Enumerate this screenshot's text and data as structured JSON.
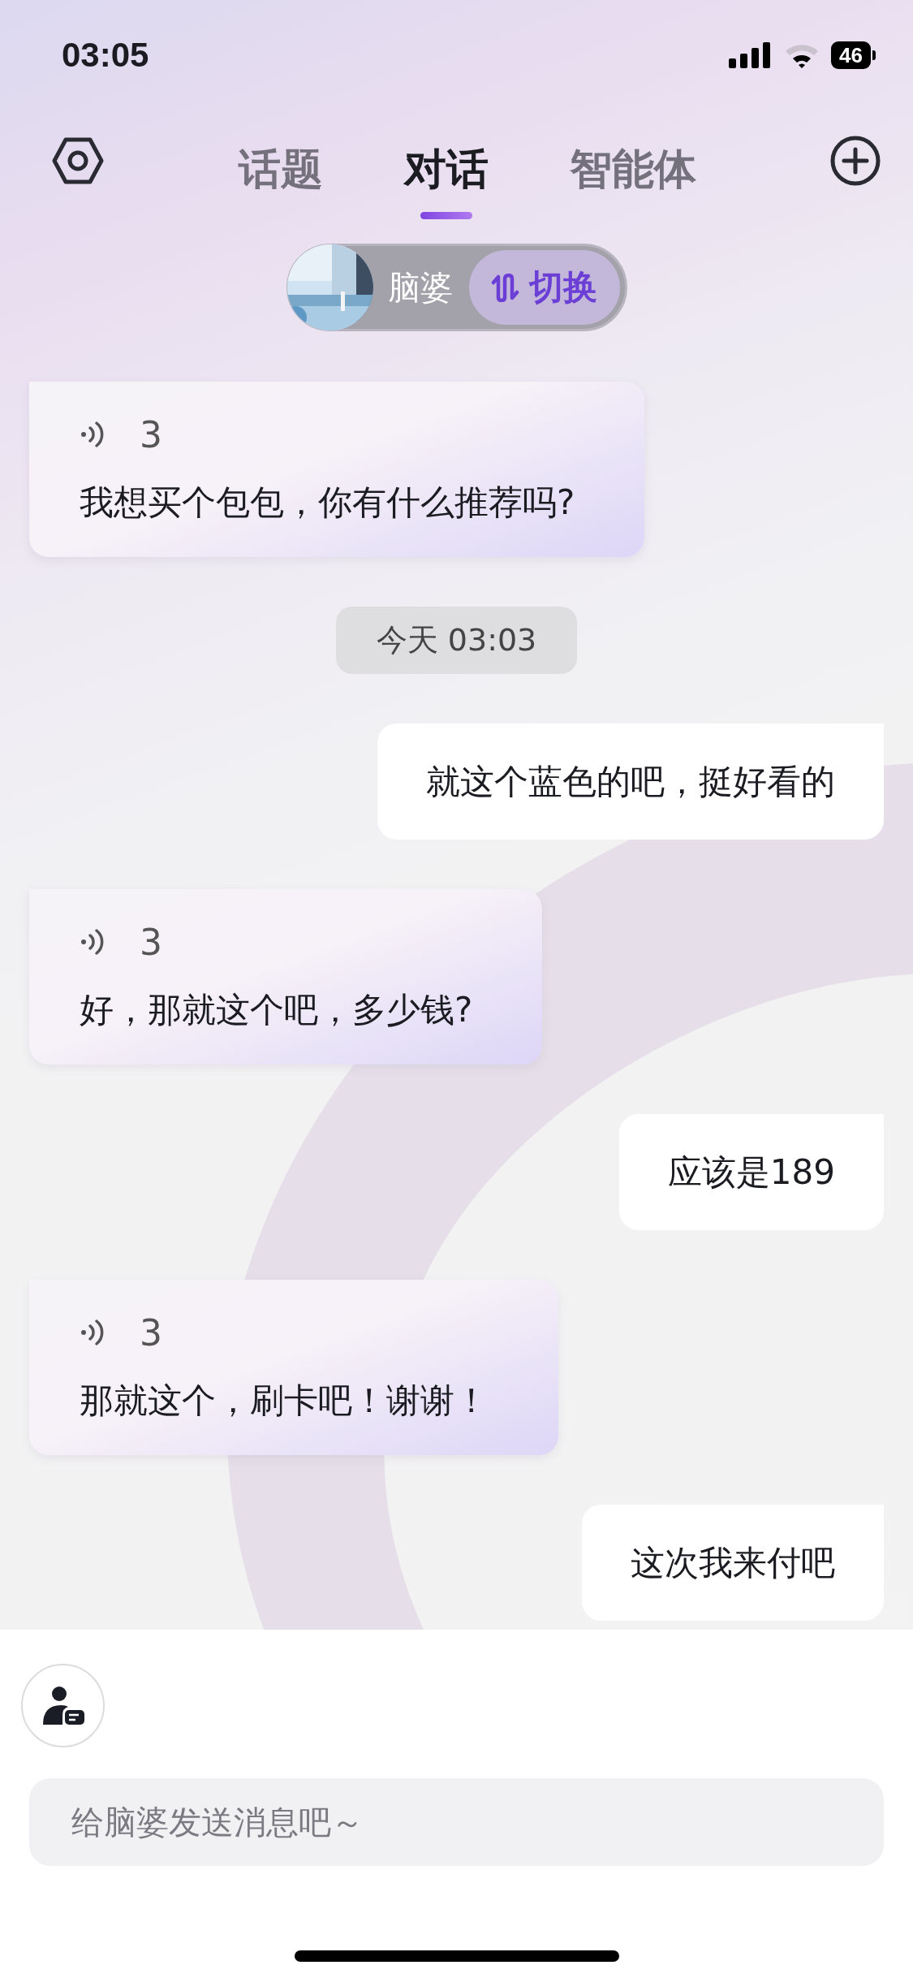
{
  "status_bar": {
    "time": "03:05",
    "battery": "46"
  },
  "tabs": [
    {
      "label": "话题",
      "selected": false
    },
    {
      "label": "对话",
      "selected": true
    },
    {
      "label": "智能体",
      "selected": false
    }
  ],
  "persona": {
    "name": "脑婆",
    "switch_label": "切换"
  },
  "messages": [
    {
      "kind": "bot",
      "count": "3",
      "text": "我想买个包包，你有什么推荐吗?"
    },
    {
      "kind": "time",
      "text": "今天 03:03"
    },
    {
      "kind": "user",
      "text": "就这个蓝色的吧，挺好看的"
    },
    {
      "kind": "bot",
      "count": "3",
      "text": "好，那就这个吧，多少钱?"
    },
    {
      "kind": "user",
      "text": "应该是189"
    },
    {
      "kind": "bot",
      "count": "3",
      "text": "那就这个，刷卡吧！谢谢！"
    },
    {
      "kind": "user",
      "text": "这次我来付吧"
    }
  ],
  "composer": {
    "placeholder": "给脑婆发送消息吧～"
  }
}
